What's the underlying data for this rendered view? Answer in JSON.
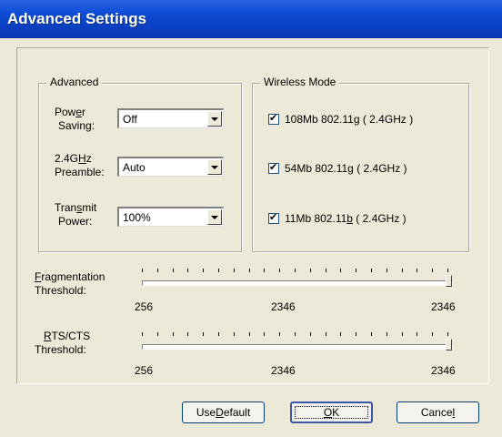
{
  "window": {
    "title": "Advanced Settings"
  },
  "advanced": {
    "group_title": "Advanced",
    "power_saving": {
      "label_line1_pre": "Pow",
      "label_line1_u": "e",
      "label_line1_post": "r",
      "label_line2": "Saving:",
      "value": "Off"
    },
    "preamble": {
      "label_line1_pre": "2.4G",
      "label_line1_u": "H",
      "label_line1_post": "z",
      "label_line2": "Preamble:",
      "value": "Auto"
    },
    "transmit_power": {
      "label_line1_pre": "Tran",
      "label_line1_u": "s",
      "label_line1_post": "mit",
      "label_line2": "Power:",
      "value": "100%"
    }
  },
  "wireless_mode": {
    "group_title": "Wireless Mode",
    "options": [
      {
        "pre": "108Mb 802.11g ( 2.4GHz )",
        "u": "",
        "post": "",
        "checked": true
      },
      {
        "pre": "54Mb 802.11",
        "u": "g",
        "post": " ( 2.4GHz )",
        "checked": true
      },
      {
        "pre": "11Mb 802.11",
        "u": "b",
        "post": " ( 2.4GHz )",
        "checked": true
      }
    ]
  },
  "fragmentation": {
    "label_u": "F",
    "label_rest": "ragmentation",
    "label_line2": "Threshold:",
    "min": "256",
    "mid": "2346",
    "max": "2346",
    "value": 2346,
    "range": [
      256,
      2346
    ]
  },
  "rts_cts": {
    "label_u": "R",
    "label_rest": "TS/CTS",
    "label_line2": "Threshold:",
    "min": "256",
    "mid": "2346",
    "max": "2346",
    "value": 2346,
    "range": [
      256,
      2346
    ]
  },
  "buttons": {
    "use_default_pre": "Use ",
    "use_default_u": "D",
    "use_default_post": "efault",
    "ok_u": "O",
    "ok_post": "K",
    "cancel_pre": "Cance",
    "cancel_u": "l",
    "cancel_post": ""
  }
}
